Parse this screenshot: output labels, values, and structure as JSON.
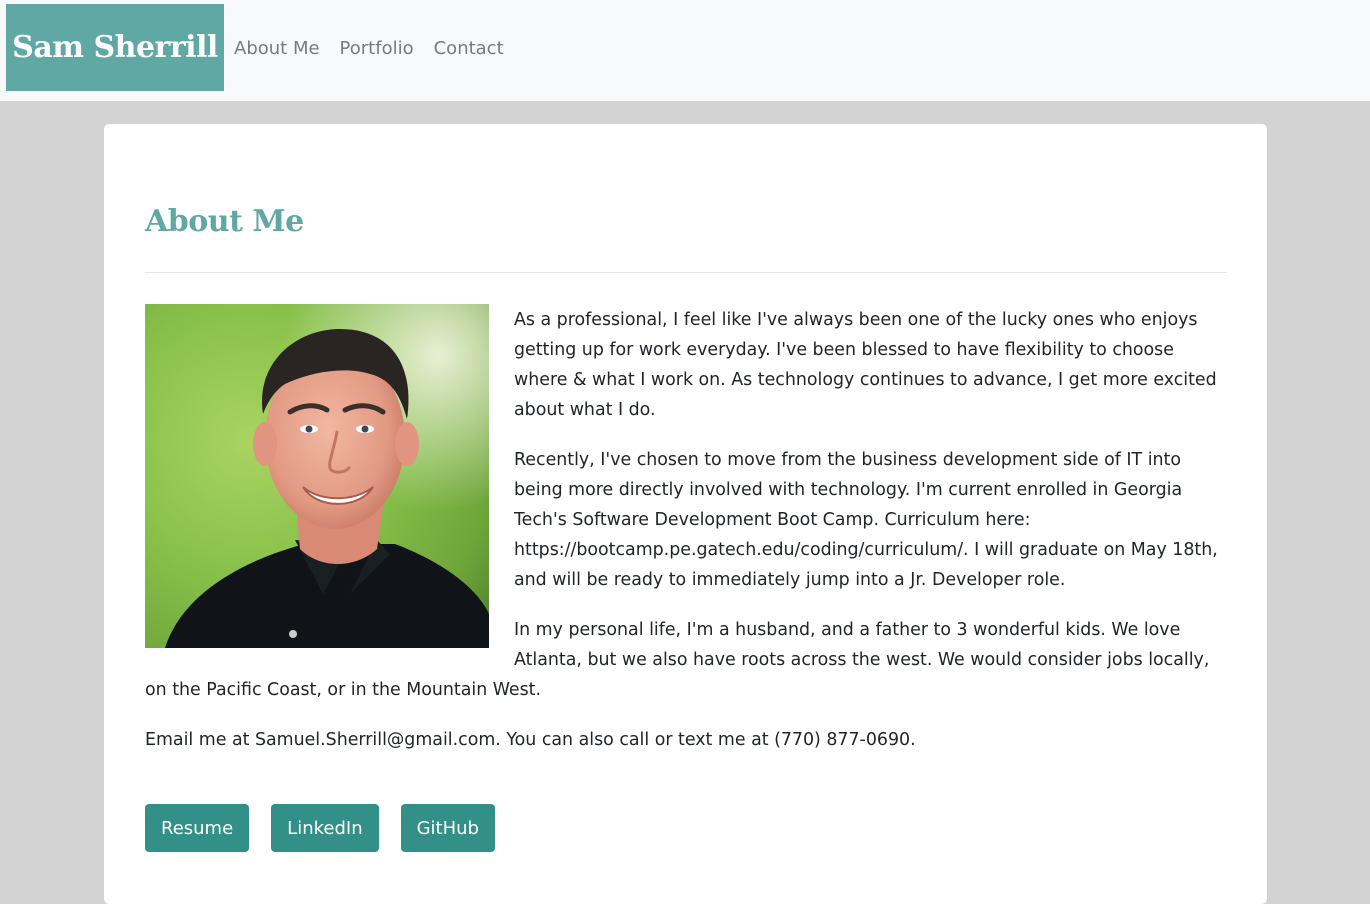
{
  "navbar": {
    "brand": "Sam Sherrill",
    "links": [
      "About Me",
      "Portfolio",
      "Contact"
    ]
  },
  "main": {
    "title": "About Me",
    "paragraphs": [
      "As a professional, I feel like I've always been one of the lucky ones who enjoys getting up for work everyday. I've been blessed to have flexibility to choose where & what I work on. As technology continues to advance, I get more excited about what I do.",
      "Recently, I've chosen to move from the business development side of IT into being more directly involved with technology. I'm current enrolled in Georgia Tech's Software Development Boot Camp. Curriculum here: https://bootcamp.pe.gatech.edu/coding/curriculum/. I will graduate on May 18th, and will be ready to immediately jump into a Jr. Developer role.",
      "In my personal life, I'm a husband, and a father to 3 wonderful kids. We love Atlanta, but we also have roots across the west. We would consider jobs locally, on the Pacific Coast, or in the Mountain West.",
      "Email me at Samuel.Sherrill@gmail.com. You can also call or text me at (770) 877-0690."
    ],
    "buttons": [
      "Resume",
      "LinkedIn",
      "GitHub"
    ]
  },
  "colors": {
    "accent": "#5fa8a3",
    "button": "#329088",
    "background": "#d3d3d3",
    "navbar": "#f8f9fa"
  }
}
